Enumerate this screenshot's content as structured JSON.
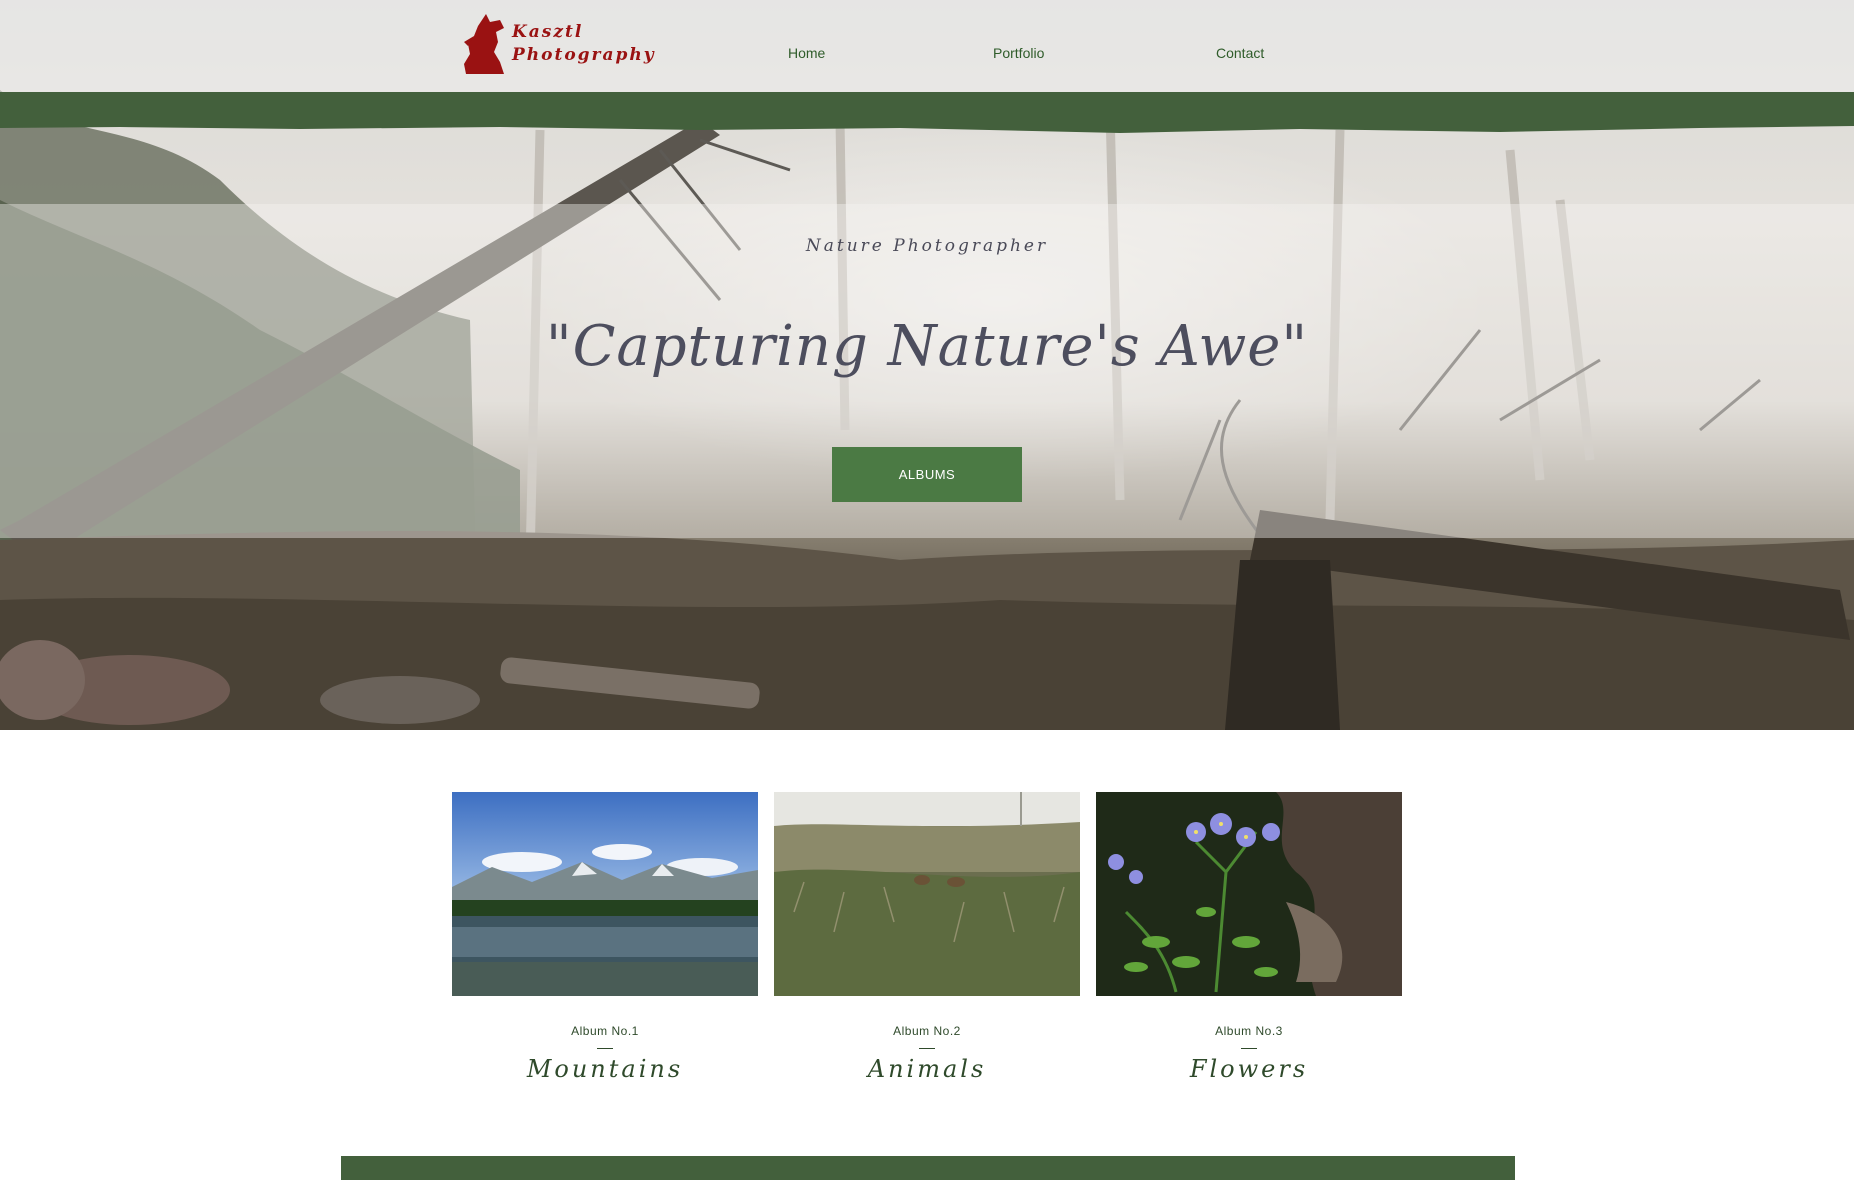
{
  "site": {
    "logo_line1": "Kasztl",
    "logo_line2": "Photography",
    "logo_icon": "wolf-howl-icon",
    "brand_color": "#9a1212",
    "accent_green": "#43603c"
  },
  "nav": {
    "items": [
      {
        "label": "Home"
      },
      {
        "label": "Portfolio"
      },
      {
        "label": "Contact"
      }
    ]
  },
  "hero": {
    "tagline": "Nature Photographer",
    "headline": "\"Capturing Nature's Awe\"",
    "button_label": "ALBUMS",
    "button_color": "#4b7a44"
  },
  "albums": [
    {
      "number": "Album No.1",
      "title": "Mountains"
    },
    {
      "number": "Album No.2",
      "title": "Animals"
    },
    {
      "number": "Album No.3",
      "title": "Flowers"
    }
  ]
}
